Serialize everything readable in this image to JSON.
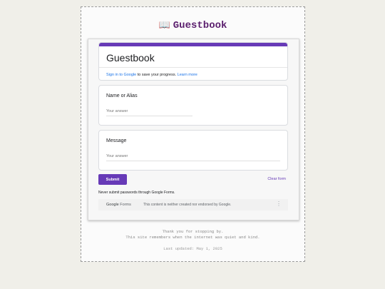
{
  "site": {
    "title": "Guestbook",
    "icon": "open-book-icon"
  },
  "form": {
    "title": "Guestbook",
    "signin_link": "Sign in to Google",
    "signin_text": " to save your progress. ",
    "learn_more": "Learn more",
    "questions": [
      {
        "label": "Name or Alias",
        "placeholder": "Your answer"
      },
      {
        "label": "Message",
        "placeholder": "Your answer"
      }
    ],
    "submit_label": "Submit",
    "clear_label": "Clear form",
    "never_submit": "Never submit passwords through Google Forms.",
    "footer_logo_a": "Google",
    "footer_logo_b": "Forms",
    "disclaimer": "This content is neither created nor endorsed by Google.",
    "accent_color": "#673ab7"
  },
  "page_footer": {
    "line1": "Thank you for stopping by.",
    "line2": "This site remembers when the internet was quiet and kind.",
    "updated": "Last updated: May 1, 2025"
  }
}
